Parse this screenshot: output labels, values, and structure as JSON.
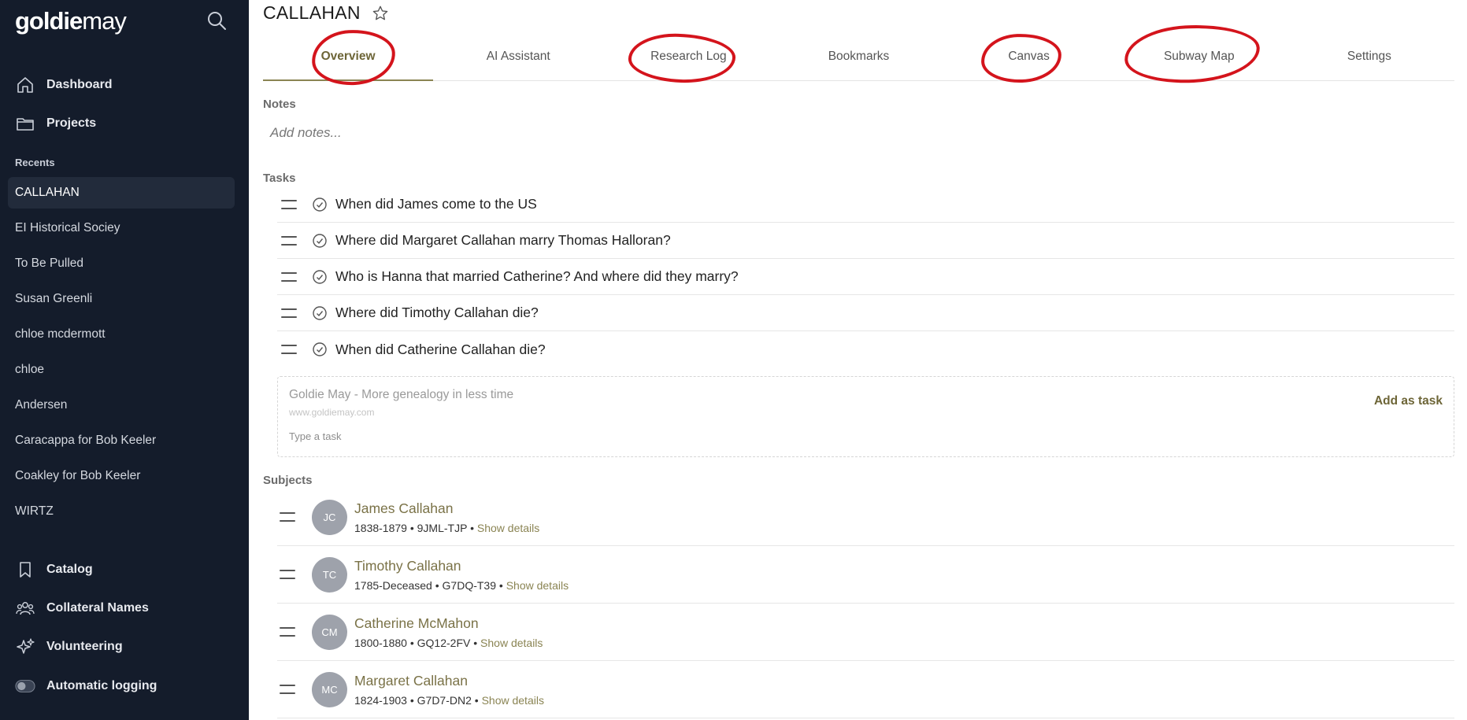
{
  "brand": {
    "bold": "goldie",
    "light": "may"
  },
  "sidebar": {
    "nav_top": [
      {
        "label": "Dashboard",
        "icon": "home-icon"
      },
      {
        "label": "Projects",
        "icon": "folder-icon"
      }
    ],
    "recents_label": "Recents",
    "recents": [
      "CALLAHAN",
      "EI Historical Sociey",
      "To Be Pulled",
      "Susan Greenli",
      "chloe mcdermott",
      "chloe",
      "Andersen",
      "Caracappa for Bob Keeler",
      "Coakley for Bob Keeler",
      "WIRTZ"
    ],
    "nav_bottom": [
      {
        "label": "Catalog",
        "icon": "bookmark-icon"
      },
      {
        "label": "Collateral Names",
        "icon": "people-icon"
      },
      {
        "label": "Volunteering",
        "icon": "sparkle-icon"
      },
      {
        "label": "Automatic logging",
        "icon": "toggle-icon"
      }
    ]
  },
  "project": {
    "title": "CALLAHAN"
  },
  "tabs": [
    "Overview",
    "AI Assistant",
    "Research Log",
    "Bookmarks",
    "Canvas",
    "Subway Map",
    "Settings"
  ],
  "notes": {
    "heading": "Notes",
    "placeholder": "Add notes..."
  },
  "tasks": {
    "heading": "Tasks",
    "items": [
      "When did James come to the US",
      "Where did Margaret Callahan marry Thomas Halloran?",
      "Who is Hanna that married Catherine? And where did they marry?",
      "Where did Timothy Callahan die?",
      "When did Catherine Callahan die?"
    ],
    "suggestion_title": "Goldie May - More genealogy in less time",
    "suggestion_url": "www.goldiemay.com",
    "input_placeholder": "Type a task",
    "add_label": "Add as task"
  },
  "subjects": {
    "heading": "Subjects",
    "items": [
      {
        "initials": "JC",
        "name": "James Callahan",
        "years": "1838-1879",
        "id": "9JML-TJP",
        "details": "Show details"
      },
      {
        "initials": "TC",
        "name": "Timothy Callahan",
        "years": "1785-Deceased",
        "id": "G7DQ-T39",
        "details": "Show details"
      },
      {
        "initials": "CM",
        "name": "Catherine McMahon",
        "years": "1800-1880",
        "id": "GQ12-2FV",
        "details": "Show details"
      },
      {
        "initials": "MC",
        "name": "Margaret Callahan",
        "years": "1824-1903",
        "id": "G7D7-DN2",
        "details": "Show details"
      }
    ],
    "separator": " • "
  },
  "colors": {
    "sidebar_bg": "#141c2b",
    "accent": "#7a7247",
    "annotation": "#d4141c"
  }
}
